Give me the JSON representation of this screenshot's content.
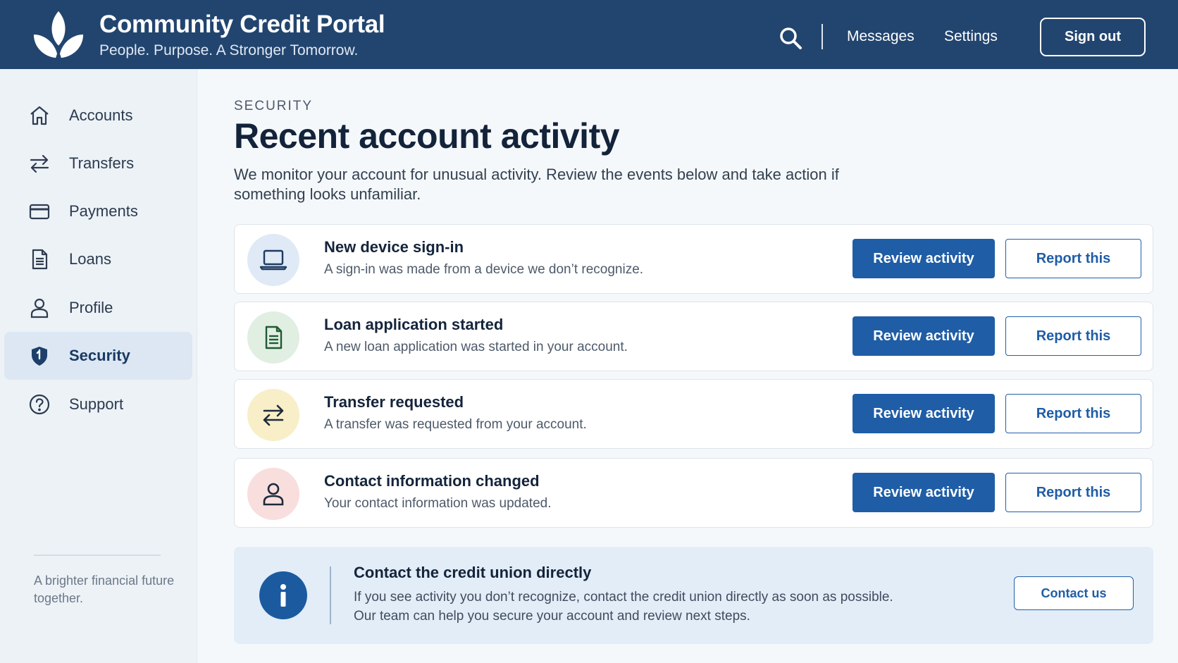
{
  "header": {
    "title": "Community Credit Portal",
    "tagline": "People. Purpose. A Stronger Tomorrow.",
    "nav": {
      "messages": "Messages",
      "settings": "Settings"
    },
    "sign_out": "Sign out",
    "colors": {
      "background": "#22456f",
      "text": "#ffffff"
    }
  },
  "sidebar": {
    "items": [
      {
        "label": "Accounts",
        "icon": "home-icon"
      },
      {
        "label": "Transfers",
        "icon": "transfer-arrows-icon"
      },
      {
        "label": "Payments",
        "icon": "credit-card-icon"
      },
      {
        "label": "Loans",
        "icon": "document-icon"
      },
      {
        "label": "Profile",
        "icon": "user-icon"
      },
      {
        "label": "Security",
        "icon": "shield-icon",
        "active": true
      },
      {
        "label": "Support",
        "icon": "help-icon"
      }
    ],
    "footer": "A brighter financial future together."
  },
  "main": {
    "eyebrow": "SECURITY",
    "title": "Recent account activity",
    "description": "We monitor your account for unusual activity. Review the events below and take action if something looks unfamiliar.",
    "events": [
      {
        "title": "New device sign-in",
        "description": "A sign-in was made from a device we don’t recognize.",
        "icon": "laptop-icon",
        "icon_bg": "#dfeaf6",
        "review_label": "Review activity",
        "report_label": "Report this"
      },
      {
        "title": "Loan application started",
        "description": "A new loan application was started in your account.",
        "icon": "document-icon",
        "icon_bg": "#e0efe2",
        "review_label": "Review activity",
        "report_label": "Report this"
      },
      {
        "title": "Transfer requested",
        "description": "A transfer was requested from your account.",
        "icon": "transfer-arrows-icon",
        "icon_bg": "#f8eec8",
        "review_label": "Review activity",
        "report_label": "Report this"
      },
      {
        "title": "Contact information changed",
        "description": "Your contact information was updated.",
        "icon": "user-icon",
        "icon_bg": "#f8dedd",
        "review_label": "Review activity",
        "report_label": "Report this"
      }
    ],
    "contact": {
      "title": "Contact the credit union directly",
      "text": "If you see activity you don’t recognize, contact the credit union directly as soon as possible. Our team can help you secure your account and review next steps.",
      "button": "Contact us",
      "icon": "info-icon"
    },
    "colors": {
      "primary": "#1f5da6",
      "active_nav": "#dce7f3"
    }
  }
}
